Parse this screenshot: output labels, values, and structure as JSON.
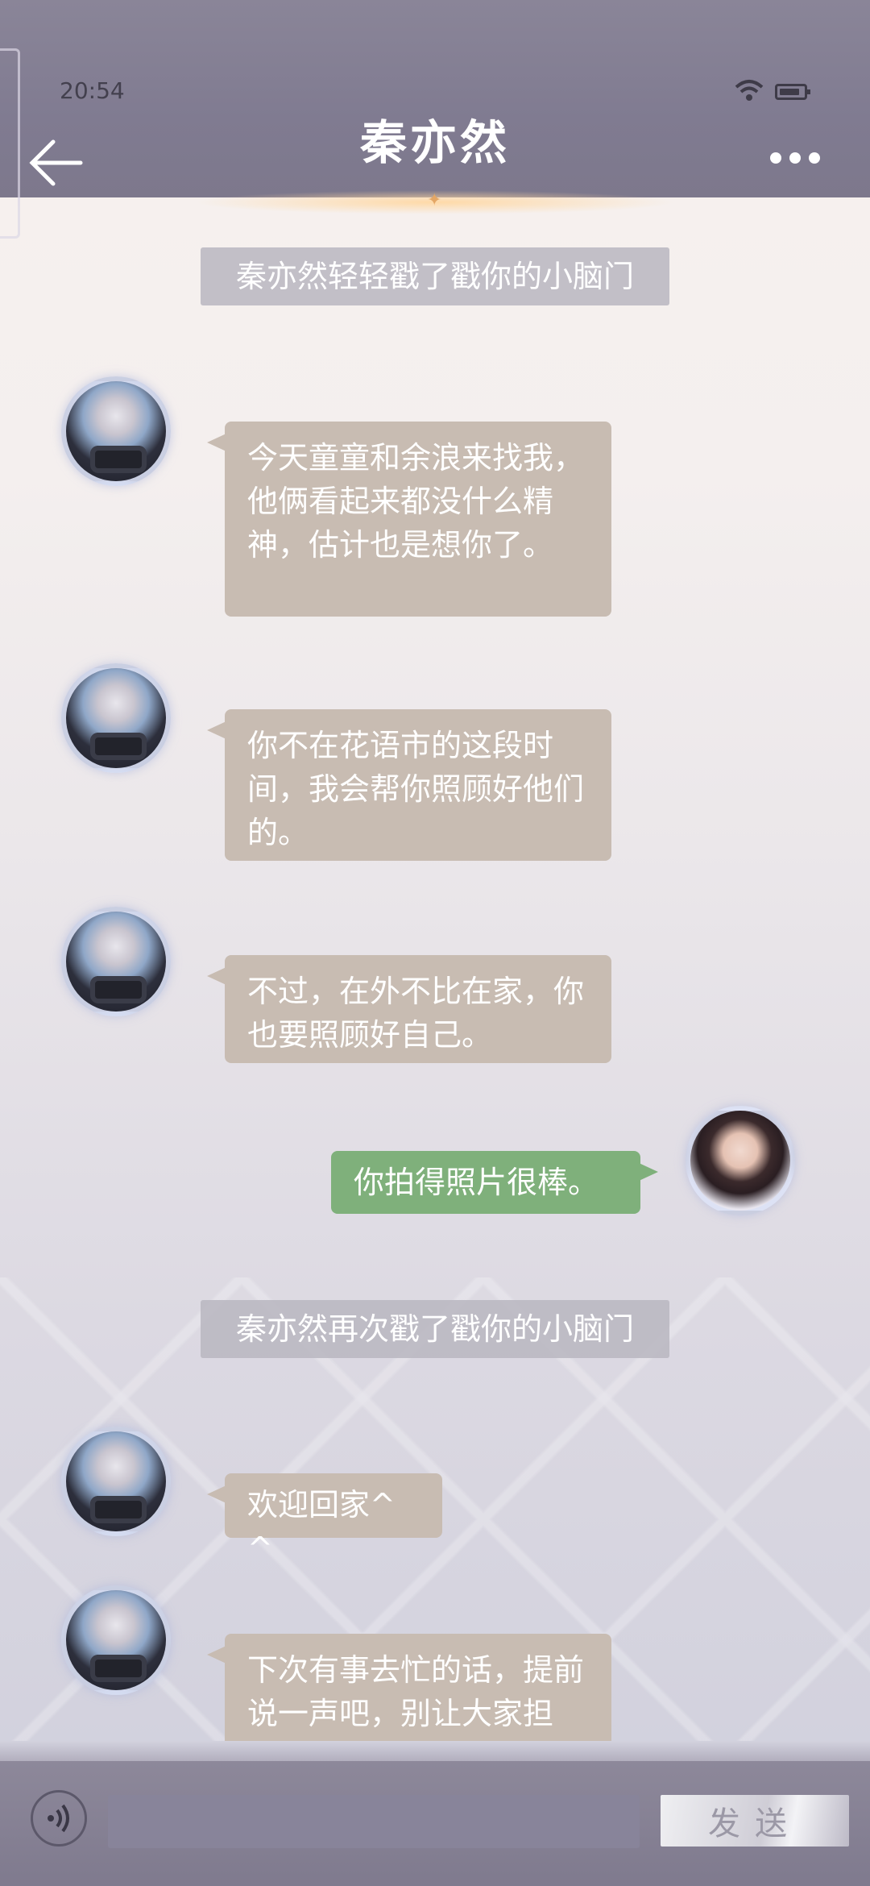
{
  "status_bar": {
    "time": "20:54"
  },
  "header": {
    "title": "秦亦然"
  },
  "messages": {
    "note1": "秦亦然轻轻戳了戳你的小脑门",
    "msg1": "今天童童和余浪来找我，他俩看起来都没什么精神，估计也是想你了。",
    "msg2": "你不在花语市的这段时间，我会帮你照顾好他们的。",
    "msg3": "不过，在外不比在家，你也要照顾好自己。",
    "msg4": "你拍得照片很棒。",
    "note2": "秦亦然再次戳了戳你的小脑门",
    "msg5": "欢迎回家^ ^",
    "msg6": "下次有事去忙的话，提前说一声吧，别让大家担心。"
  },
  "input_bar": {
    "input_value": "",
    "send_label": "发送"
  },
  "icons": {
    "back": "arrow-left-icon",
    "more": "more-dots-icon",
    "voice": "voice-icon",
    "wifi": "wifi-icon",
    "battery": "battery-icon"
  },
  "colors": {
    "header": "#807b91",
    "bubble_other": "#c8bcb2",
    "bubble_self": "#7fb07b",
    "system_note": "#b9b6c0"
  }
}
